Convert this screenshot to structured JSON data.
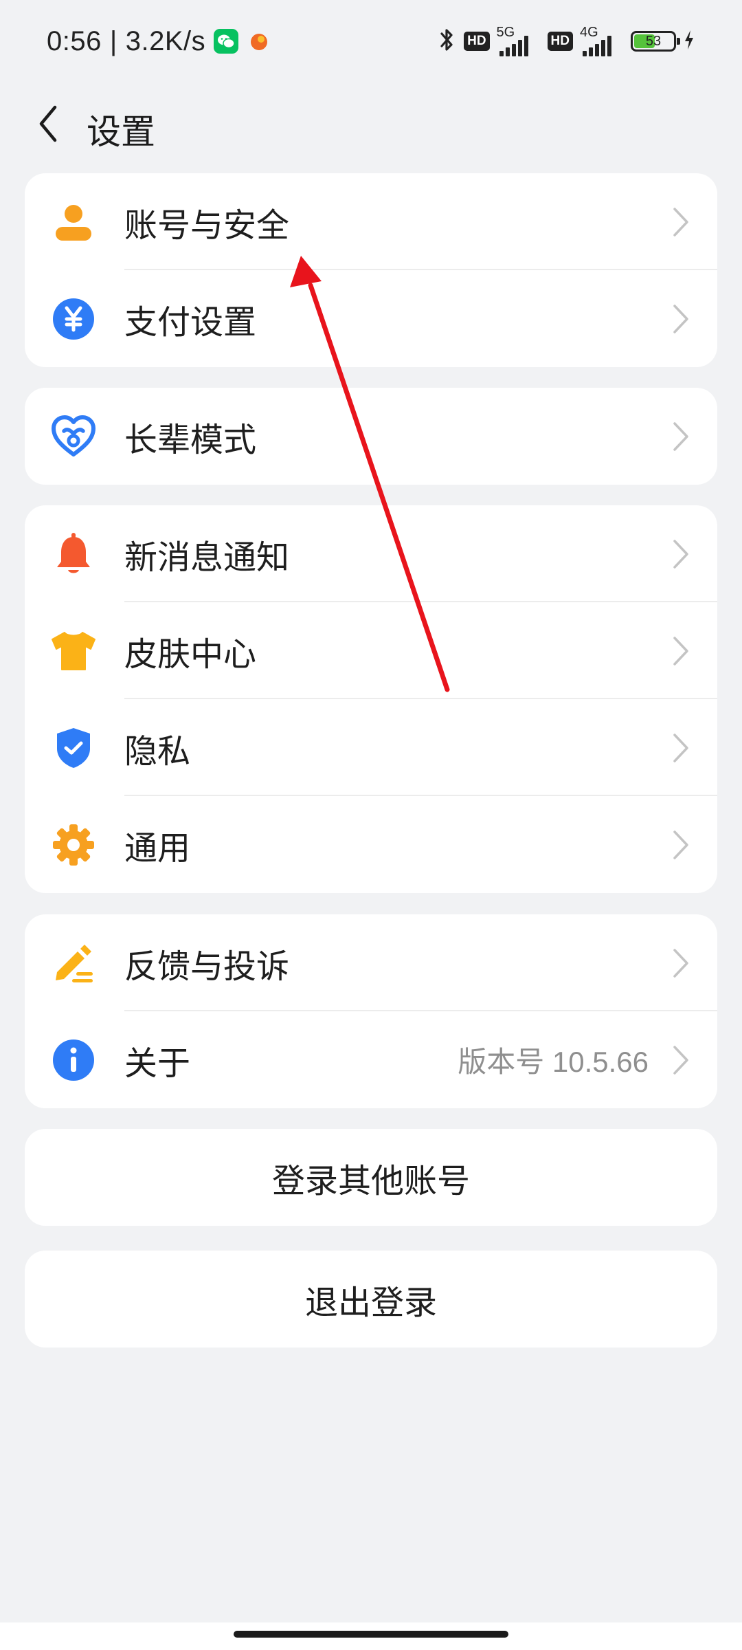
{
  "status_bar": {
    "time": "0:56",
    "separator": "|",
    "speed": "3.2K/s",
    "hd1": "HD",
    "net1": "5G",
    "hd2": "HD",
    "net2": "4G",
    "battery": "53",
    "battery_level": 0.53
  },
  "header": {
    "title": "设置"
  },
  "sections": [
    {
      "items": [
        {
          "label": "账号与安全",
          "icon": "user-icon"
        },
        {
          "label": "支付设置",
          "icon": "yuan-icon"
        }
      ]
    },
    {
      "items": [
        {
          "label": "长辈模式",
          "icon": "heart-icon"
        }
      ]
    },
    {
      "items": [
        {
          "label": "新消息通知",
          "icon": "bell-icon"
        },
        {
          "label": "皮肤中心",
          "icon": "tshirt-icon"
        },
        {
          "label": "隐私",
          "icon": "shield-check-icon"
        },
        {
          "label": "通用",
          "icon": "gear-icon"
        }
      ]
    },
    {
      "items": [
        {
          "label": "反馈与投诉",
          "icon": "edit-icon"
        },
        {
          "label": "关于",
          "icon": "info-icon",
          "value": "版本号 10.5.66"
        }
      ]
    }
  ],
  "buttons": {
    "switch_account": "登录其他账号",
    "logout": "退出登录"
  },
  "colors": {
    "background": "#f1f2f4",
    "orange": "#f7a020",
    "blue": "#2f7cf6",
    "red_orange": "#f4592f",
    "annotation_red": "#e8141c"
  }
}
